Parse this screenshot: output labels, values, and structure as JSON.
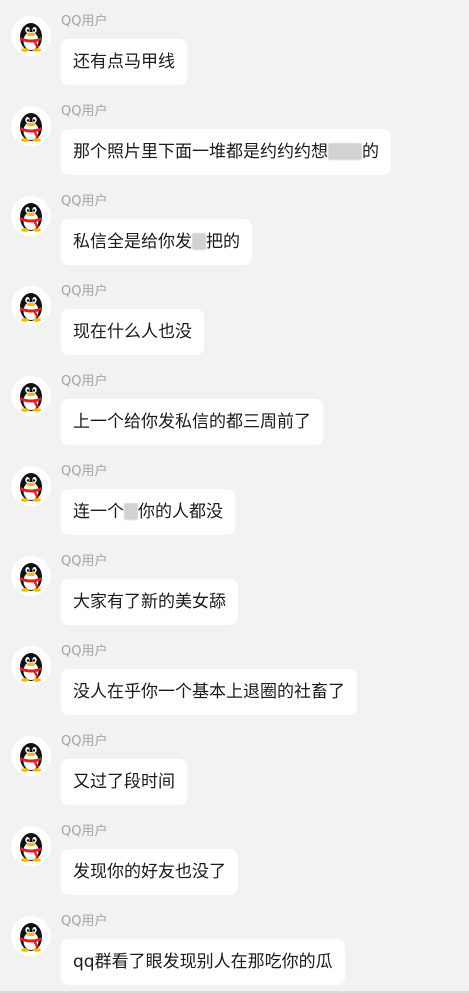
{
  "sender_name": "QQ用户",
  "messages": [
    {
      "parts": [
        "还有点马甲线"
      ]
    },
    {
      "parts": [
        "那个照片里下面一堆都是约约约想",
        "",
        "的"
      ]
    },
    {
      "parts": [
        "私信全是给你发",
        "",
        "把的"
      ]
    },
    {
      "parts": [
        "现在什么人也没"
      ]
    },
    {
      "parts": [
        "上一个给你发私信的都三周前了"
      ]
    },
    {
      "parts": [
        "连一个",
        "",
        "你的人都没"
      ]
    },
    {
      "parts": [
        "大家有了新的美女舔"
      ]
    },
    {
      "parts": [
        "没人在乎你一个基本上退圈的社畜了"
      ]
    },
    {
      "parts": [
        "又过了段时间"
      ]
    },
    {
      "parts": [
        "发现你的好友也没了"
      ]
    },
    {
      "parts": [
        "qq群看了眼发现别人在那吃你的瓜"
      ]
    }
  ]
}
